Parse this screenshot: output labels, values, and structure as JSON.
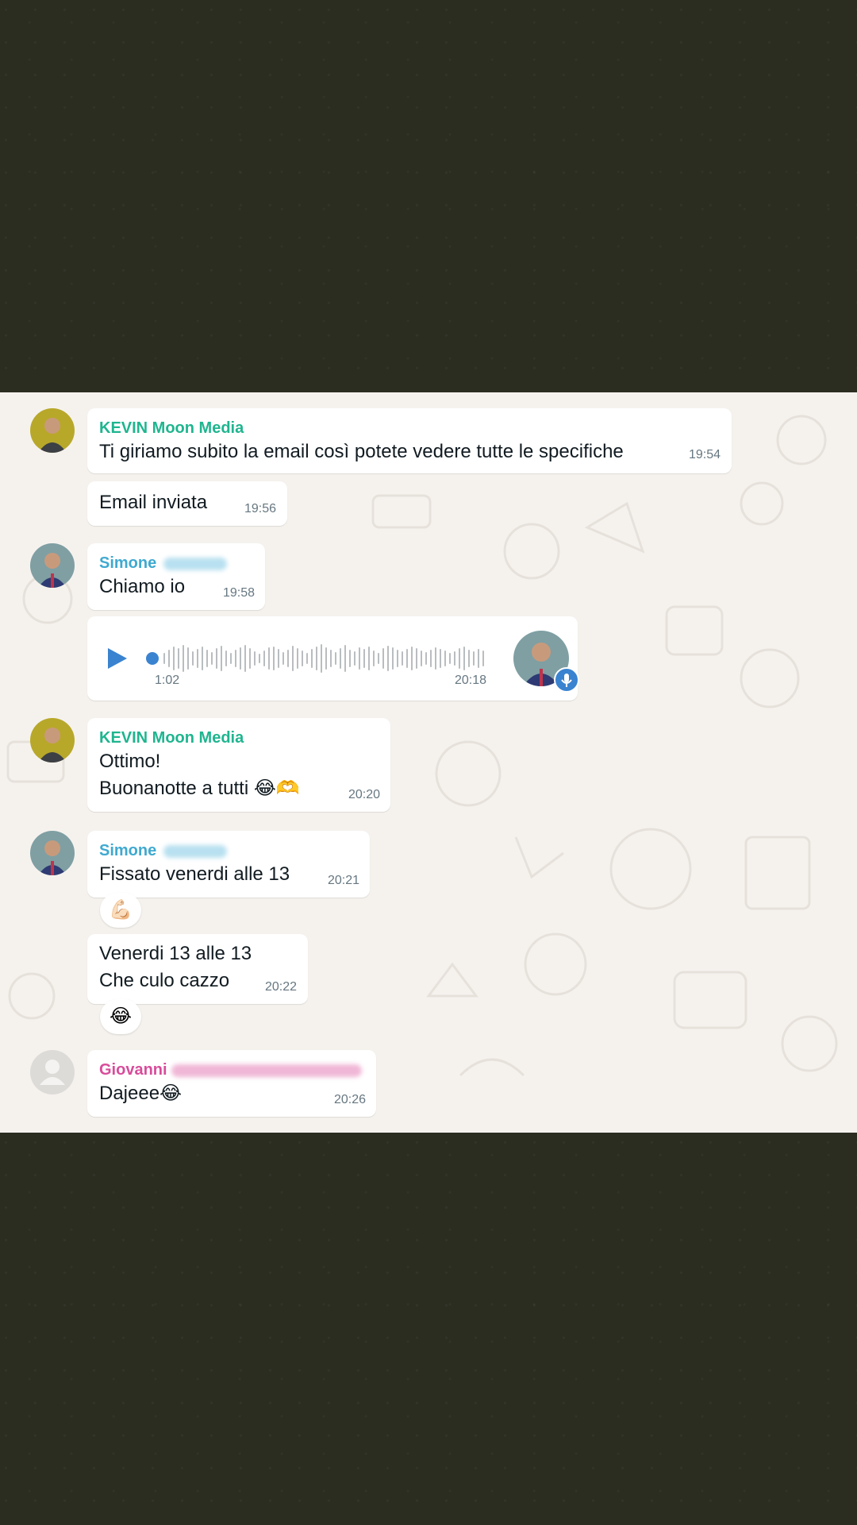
{
  "messages": [
    {
      "sender": "KEVIN Moon Media",
      "text": "Ti giriamo subito la email così potete vedere tutte le specifiche",
      "time": "19:54"
    },
    {
      "text": "Email inviata",
      "time": "19:56"
    },
    {
      "sender": "Simone",
      "text": "Chiamo io",
      "time": "19:58"
    },
    {
      "type": "voice",
      "duration": "1:02",
      "time": "20:18",
      "icon": "play-icon",
      "progress": 0.0
    },
    {
      "sender": "KEVIN Moon Media",
      "text_line1": "Ottimo!",
      "text_line2": "Buonanotte a tutti 😂🫶",
      "time": "20:20"
    },
    {
      "sender": "Simone",
      "text": "Fissato venerdi alle 13",
      "time": "20:21",
      "reaction": "💪🏻"
    },
    {
      "text_line1": "Venerdi 13 alle 13",
      "text_line2": "Che culo cazzo",
      "time": "20:22",
      "reaction": "😂"
    },
    {
      "sender": "Giovanni",
      "text": "Dajeee😂",
      "time": "20:26"
    }
  ],
  "colors": {
    "kevin": "#1fb58f",
    "simone": "#3fa9d0",
    "giovanni": "#d84c9b",
    "voice_accent": "#3a83d0"
  }
}
